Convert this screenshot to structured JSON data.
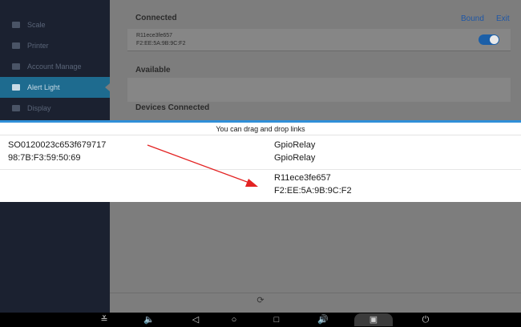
{
  "sidebar": {
    "items": [
      {
        "label": "Scale",
        "icon": "scale-icon"
      },
      {
        "label": "Printer",
        "icon": "printer-icon"
      },
      {
        "label": "Account Manage",
        "icon": "account-icon"
      },
      {
        "label": "Alert Light",
        "icon": "alert-light-icon",
        "active": true
      },
      {
        "label": "Display",
        "icon": "display-icon"
      }
    ]
  },
  "main": {
    "connected_title": "Connected",
    "bound_label": "Bound",
    "exit_label": "Exit",
    "connected_device": {
      "name": "R11ece3fe657",
      "mac": "F2:EE:5A:9B:9C:F2",
      "enabled": true
    },
    "available_title": "Available",
    "devices_connected_title": "Devices Connected"
  },
  "drag_panel": {
    "hint": "You can drag and drop links",
    "left_device": {
      "name": "SO0120023c653f679717",
      "mac": "98:7B:F3:59:50:69"
    },
    "right_devices": [
      {
        "name": "GpioRelay",
        "mac": "GpioRelay"
      },
      {
        "name": "R11ece3fe657",
        "mac": "F2:EE:5A:9B:9C:F2"
      }
    ]
  },
  "refresh": {
    "icon": "refresh-icon",
    "glyph": "⟳"
  },
  "navbar": {
    "items": [
      {
        "name": "hide-nav-icon",
        "glyph": "≚"
      },
      {
        "name": "volume-down-icon",
        "glyph": "🔈"
      },
      {
        "name": "back-icon",
        "glyph": "◁"
      },
      {
        "name": "home-icon",
        "glyph": "○"
      },
      {
        "name": "recents-icon",
        "glyph": "□"
      },
      {
        "name": "volume-up-icon",
        "glyph": "🔊"
      },
      {
        "name": "screenshot-icon",
        "glyph": "▣"
      },
      {
        "name": "power-icon",
        "glyph": "⏻"
      }
    ]
  },
  "colors": {
    "accent": "#2f8fd8",
    "sidebar_active": "#1e6b8f",
    "arrow": "#e32222",
    "link": "#1f57a6"
  }
}
